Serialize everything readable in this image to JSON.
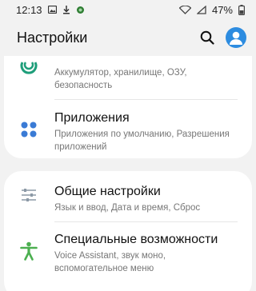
{
  "status_bar": {
    "time": "12:13",
    "battery": "47%",
    "icons": [
      "gallery-icon",
      "download-icon",
      "app-notification-icon",
      "wifi-icon",
      "signal-icon",
      "battery-icon"
    ]
  },
  "header": {
    "title": "Настройки",
    "search_icon": "search-icon",
    "profile_icon": "account-icon"
  },
  "items": [
    {
      "icon": "device-care-icon",
      "title": "",
      "subtitle_lines": [
        "Аккумулятор, хранилище, ОЗУ,",
        "безопасность"
      ]
    },
    {
      "icon": "apps-icon",
      "title": "Приложения",
      "subtitle_lines": [
        "Приложения по умолчанию, Разрешения",
        "приложений"
      ]
    },
    {
      "icon": "general-settings-icon",
      "title": "Общие настройки",
      "subtitle_lines": [
        "Язык и ввод, Дата и время, Сброс"
      ]
    },
    {
      "icon": "accessibility-icon",
      "title": "Специальные возможности",
      "subtitle_lines": [
        "Voice Assistant, звук моно,",
        "вспомогательное меню"
      ]
    }
  ],
  "colors": {
    "background": "#f2f2f2",
    "card": "#ffffff",
    "accent_blue": "#2d8ce0",
    "device_care_green": "#1e9e7a",
    "apps_blue": "#3a7bd5",
    "accessibility_green": "#4caf50",
    "general_gray": "#8c99a6"
  }
}
